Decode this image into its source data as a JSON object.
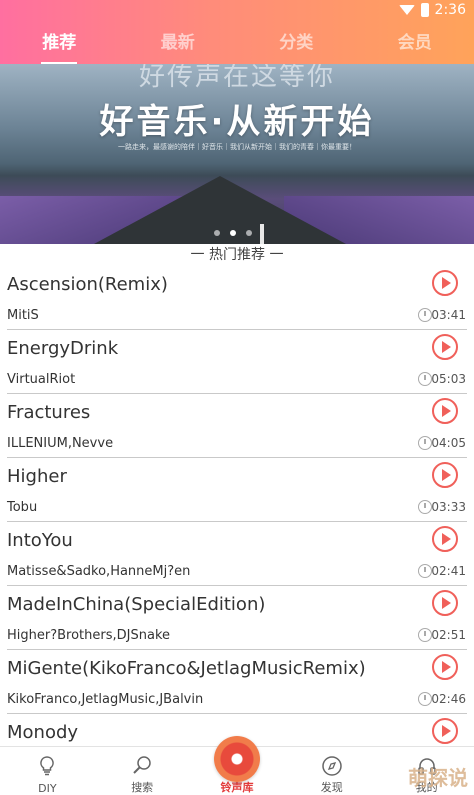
{
  "status": {
    "time": "2:36"
  },
  "tabs": [
    {
      "label": "推荐",
      "active": true
    },
    {
      "label": "最新",
      "active": false
    },
    {
      "label": "分类",
      "active": false
    },
    {
      "label": "会员",
      "active": false
    }
  ],
  "banner": {
    "line1": "好传声在这等你",
    "line2": "好音乐·从新开始",
    "subtext": "一路走来，最感谢的陪伴｜好音乐｜我们从新开始｜我们的青春｜你最重要！"
  },
  "section_title": "一 热门推荐 一",
  "songs": [
    {
      "title": "Ascension(Remix)",
      "artist": "MitiS",
      "duration": "03:41"
    },
    {
      "title": "EnergyDrink",
      "artist": "VirtualRiot",
      "duration": "05:03"
    },
    {
      "title": "Fractures",
      "artist": "ILLENIUM,Nevve",
      "duration": "04:05"
    },
    {
      "title": "Higher",
      "artist": "Tobu",
      "duration": "03:33"
    },
    {
      "title": "IntoYou",
      "artist": "Matisse&Sadko,HanneMj?en",
      "duration": "02:41"
    },
    {
      "title": "MadeInChina(SpecialEdition)",
      "artist": "Higher?Brothers,DJSnake",
      "duration": "02:51"
    },
    {
      "title": "MiGente(KikoFranco&JetlagMusicRemix)",
      "artist": "KikoFranco,JetlagMusic,JBalvin",
      "duration": "02:46"
    },
    {
      "title": "Monody",
      "artist": "",
      "duration": ""
    }
  ],
  "nav": [
    {
      "label": "DIY",
      "icon": "bulb-icon"
    },
    {
      "label": "搜索",
      "icon": "search-icon"
    },
    {
      "label": "铃声库",
      "icon": "disc-icon",
      "active": true
    },
    {
      "label": "发现",
      "icon": "compass-icon"
    },
    {
      "label": "我的",
      "icon": "headphones-icon"
    }
  ],
  "watermark": "萌探说",
  "colors": {
    "accent": "#e23b3b",
    "play": "#f0605a",
    "header_start": "#ff6fa0",
    "header_end": "#ffa35a"
  }
}
